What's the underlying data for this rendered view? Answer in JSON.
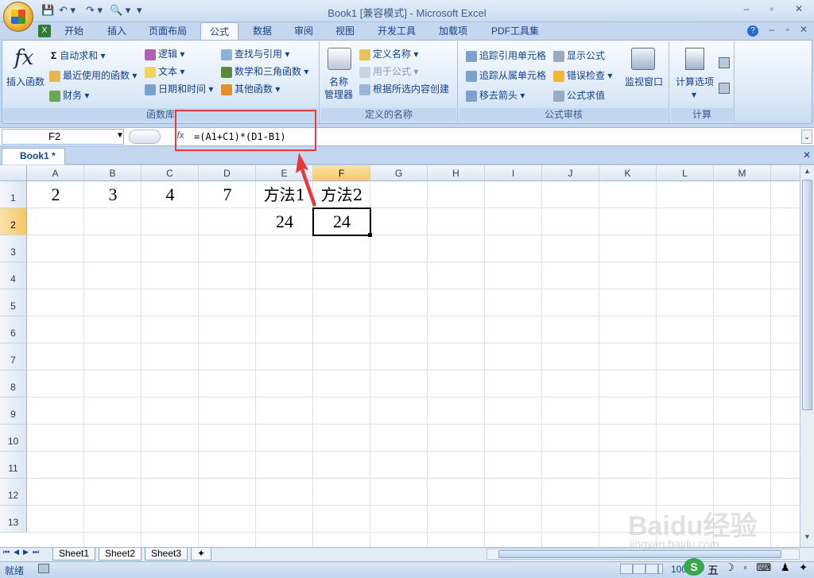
{
  "title_bar": {
    "title": "Book1  [兼容模式] - Microsoft Excel",
    "save_icon": "save-icon",
    "undo_icon": "undo-icon",
    "redo_icon": "redo-icon",
    "preview_icon": "print-preview-icon"
  },
  "window": {
    "minimize": "–",
    "restore": "▫",
    "close": "✕"
  },
  "tabs": [
    {
      "label": "开始"
    },
    {
      "label": "插入"
    },
    {
      "label": "页面布局"
    },
    {
      "label": "公式",
      "active": true
    },
    {
      "label": "数据"
    },
    {
      "label": "审阅"
    },
    {
      "label": "视图"
    },
    {
      "label": "开发工具"
    },
    {
      "label": "加载项"
    },
    {
      "label": "PDF工具集"
    }
  ],
  "ribbon": {
    "function_library": {
      "label": "函数库",
      "insert_function": "插入函数",
      "autosum": "自动求和",
      "recent": "最近使用的函数",
      "financial": "财务",
      "logical": "逻辑",
      "text": "文本",
      "datetime": "日期和时间",
      "lookup": "查找与引用",
      "math": "数学和三角函数",
      "other": "其他函数"
    },
    "defined_names": {
      "label": "定义的名称",
      "name_manager_1": "名称",
      "name_manager_2": "管理器",
      "define_name": "定义名称",
      "use_in_formula": "用于公式",
      "create_from_selection": "根据所选内容创建"
    },
    "formula_auditing": {
      "label": "公式审核",
      "trace_precedents": "追踪引用单元格",
      "trace_dependents": "追踪从属单元格",
      "remove_arrows": "移去箭头",
      "show_formulas": "显示公式",
      "error_checking": "错误检查",
      "evaluate_formula": "公式求值",
      "watch_window": "监视窗口"
    },
    "calculation": {
      "label": "计算",
      "options": "计算选项"
    }
  },
  "formula_bar": {
    "name_box": "F2",
    "fx": "fx",
    "formula": "=(A1+C1)*(D1-B1)"
  },
  "workbook_tab": {
    "label": "Book1 *"
  },
  "columns": [
    "A",
    "B",
    "C",
    "D",
    "E",
    "F",
    "G",
    "H",
    "I",
    "J",
    "K",
    "L",
    "M"
  ],
  "rows": [
    "1",
    "2",
    "3",
    "4",
    "5",
    "6",
    "7",
    "8",
    "9",
    "10",
    "11",
    "12",
    "13"
  ],
  "cells": {
    "A1": "2",
    "B1": "3",
    "C1": "4",
    "D1": "7",
    "E1": "方法1",
    "F1": "方法2",
    "E2": "24",
    "F2": "24"
  },
  "selected_cell": "F2",
  "sheets": [
    {
      "label": "Sheet1"
    },
    {
      "label": "Sheet2",
      "active": true
    },
    {
      "label": "Sheet3"
    }
  ],
  "status": {
    "mode": "就绪",
    "zoom": "100",
    "ime": "五"
  },
  "watermark": {
    "text": "Baidu经验",
    "url": "jingyan.baidu.com"
  },
  "colors": {
    "accent": "#15428b",
    "highlight_box": "#e8393a",
    "selected_header": "#f6c866"
  }
}
